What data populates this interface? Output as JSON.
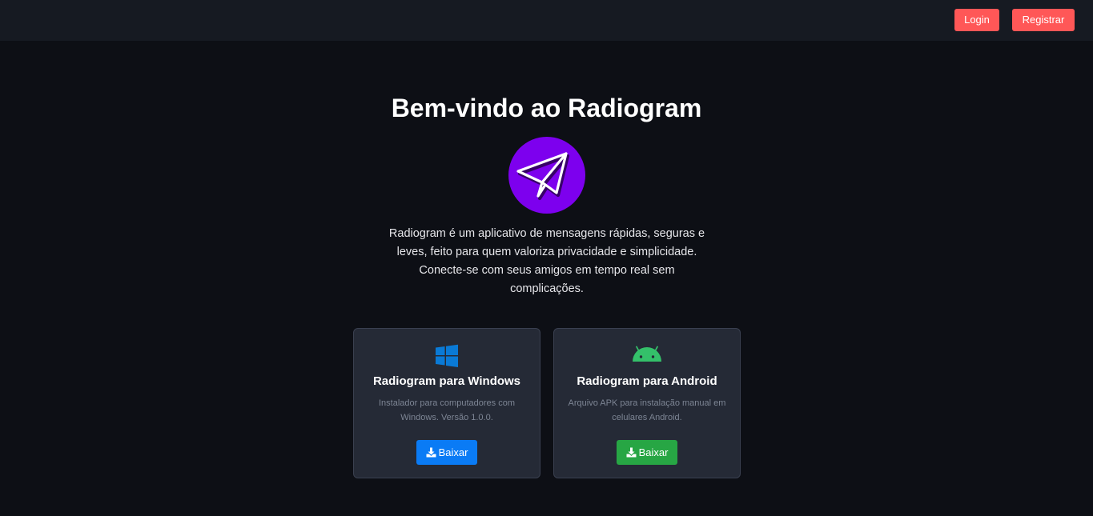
{
  "header": {
    "login_label": "Login",
    "register_label": "Registrar"
  },
  "hero": {
    "title": "Bem-vindo ao Radiogram",
    "logo_icon": "paper-plane-icon",
    "description": "Radiogram é um aplicativo de mensagens rápidas, seguras e leves, feito para quem valoriza privacidade e simplicidade. Conecte-se com seus amigos em tempo real sem complicações."
  },
  "downloads": [
    {
      "icon": "windows-icon",
      "title": "Radiogram para Windows",
      "description": "Instalador para computadores com Windows. Versão 1.0.0.",
      "button_label": "Baixar",
      "button_color": "#0a7bf5"
    },
    {
      "icon": "android-icon",
      "title": "Radiogram para Android",
      "description": "Arquivo APK para instalação manual em celulares Android.",
      "button_label": "Baixar",
      "button_color": "#27a644"
    }
  ],
  "colors": {
    "accent": "#ff5757",
    "logo_bg": "#7d00ee",
    "background": "#0d0f15",
    "card_bg": "#252a36"
  }
}
